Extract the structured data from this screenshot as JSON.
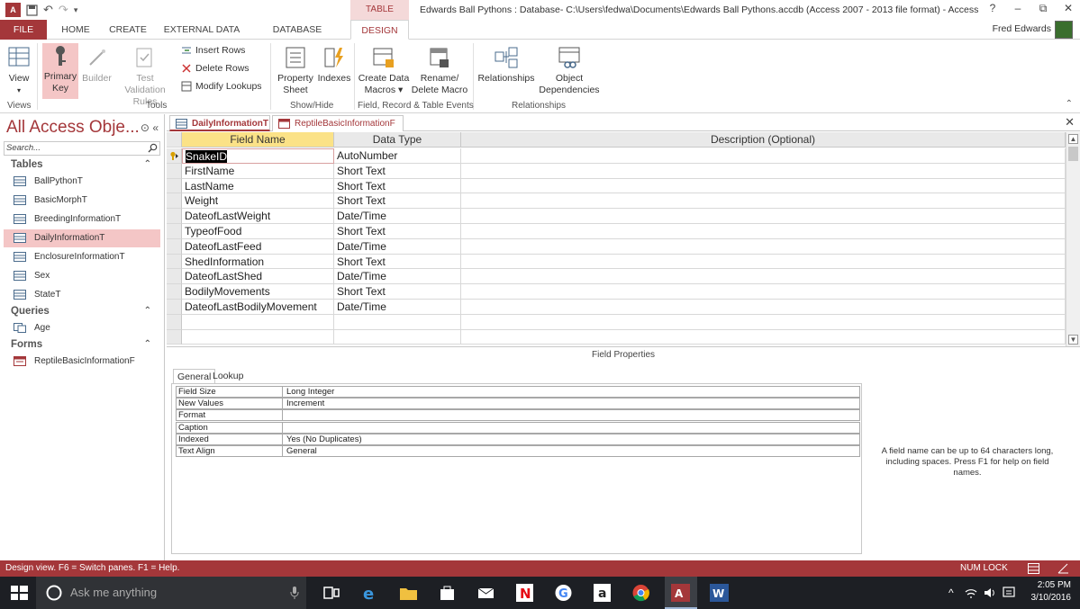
{
  "title": {
    "ctx_tab": "TABLE TOOLS",
    "text": "Edwards Ball Pythons : Database- C:\\Users\\fedwa\\Documents\\Edwards Ball Pythons.accdb (Access 2007 - 2013 file format) - Access",
    "help": "?",
    "minimize": "–",
    "restore": "⧉",
    "close": "✕"
  },
  "tabs": {
    "file": "FILE",
    "home": "HOME",
    "create": "CREATE",
    "external": "EXTERNAL DATA",
    "dbtools": "DATABASE TOOLS",
    "design": "DESIGN",
    "user": "Fred Edwards"
  },
  "ribbon": {
    "view": "View",
    "primary_key_1": "Primary",
    "primary_key_2": "Key",
    "builder": "Builder",
    "test_validation_1": "Test Validation",
    "test_validation_2": "Rules",
    "insert_rows": "Insert Rows",
    "delete_rows": "Delete Rows",
    "modify_lookups": "Modify Lookups",
    "property_sheet_1": "Property",
    "property_sheet_2": "Sheet",
    "indexes": "Indexes",
    "create_data_macros_1": "Create Data",
    "create_data_macros_2": "Macros",
    "rename_macro_1": "Rename/",
    "rename_macro_2": "Delete Macro",
    "relationships": "Relationships",
    "object_dep_1": "Object",
    "object_dep_2": "Dependencies",
    "groups": {
      "views": "Views",
      "tools": "Tools",
      "showhide": "Show/Hide",
      "events": "Field, Record & Table Events",
      "relationships": "Relationships"
    }
  },
  "nav": {
    "title": "All Access Obje...",
    "search_placeholder": "Search...",
    "sections": {
      "tables": "Tables",
      "queries": "Queries",
      "forms": "Forms"
    },
    "tables": [
      "BallPythonT",
      "BasicMorphT",
      "BreedingInformationT",
      "DailyInformationT",
      "EnclosureInformationT",
      "Sex",
      "StateT"
    ],
    "queries": [
      "Age"
    ],
    "forms": [
      "ReptileBasicInformationF"
    ]
  },
  "doc_tabs": [
    "DailyInformationT",
    "ReptileBasicInformationF"
  ],
  "grid": {
    "headers": [
      "Field Name",
      "Data Type",
      "Description (Optional)"
    ],
    "rows": [
      {
        "field": "SnakeID",
        "type": "AutoNumber"
      },
      {
        "field": "FirstName",
        "type": "Short Text"
      },
      {
        "field": "LastName",
        "type": "Short Text"
      },
      {
        "field": "Weight",
        "type": "Short Text"
      },
      {
        "field": "DateofLastWeight",
        "type": "Date/Time"
      },
      {
        "field": "TypeofFood",
        "type": "Short Text"
      },
      {
        "field": "DateofLastFeed",
        "type": "Date/Time"
      },
      {
        "field": "ShedInformation",
        "type": "Short Text"
      },
      {
        "field": "DateofLastShed",
        "type": "Date/Time"
      },
      {
        "field": "BodilyMovements",
        "type": "Short Text"
      },
      {
        "field": "DateofLastBodilyMovement",
        "type": "Date/Time"
      }
    ]
  },
  "field_props": {
    "title": "Field Properties",
    "tab_general": "General",
    "tab_lookup": "Lookup",
    "rows": [
      {
        "k": "Field Size",
        "v": "Long Integer"
      },
      {
        "k": "New Values",
        "v": "Increment"
      },
      {
        "k": "Format",
        "v": ""
      },
      {
        "k": "Caption",
        "v": ""
      },
      {
        "k": "Indexed",
        "v": "Yes (No Duplicates)"
      },
      {
        "k": "Text Align",
        "v": "General"
      }
    ],
    "help": "A field name can be up to 64 characters long, including spaces. Press F1 for help on field names."
  },
  "status": {
    "left": "Design view.  F6 = Switch panes.  F1 = Help.",
    "numlock": "NUM LOCK"
  },
  "taskbar": {
    "search": "Ask me anything",
    "time": "2:05 PM",
    "date": "3/10/2016"
  },
  "colors": {
    "accent": "#a4373a",
    "selection": "#f4c6c6",
    "field_header": "#fbe287"
  }
}
